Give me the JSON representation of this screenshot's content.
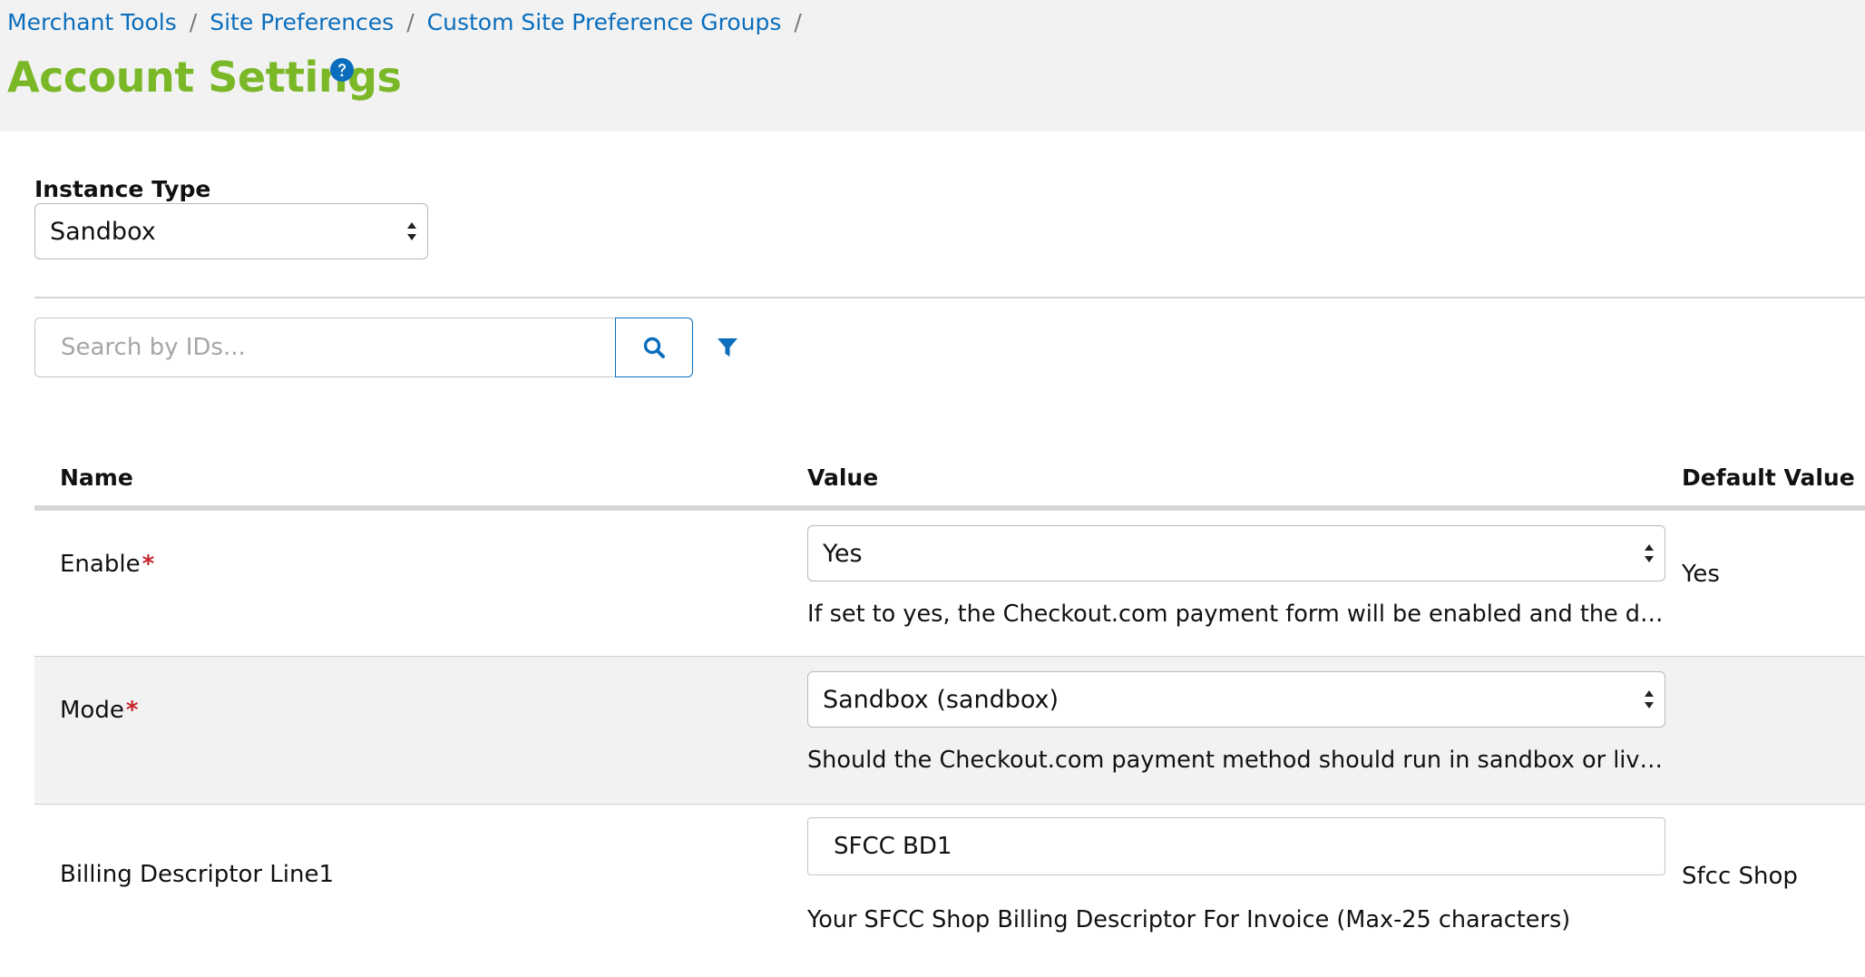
{
  "breadcrumb": {
    "items": [
      "Merchant Tools",
      "Site Preferences",
      "Custom Site Preference Groups"
    ],
    "separator": "/"
  },
  "page": {
    "title": "Account Settings",
    "help_icon": "question-circle-icon"
  },
  "instance_type": {
    "label": "Instance Type",
    "selected": "Sandbox"
  },
  "search": {
    "placeholder": "Search by IDs...",
    "value": "",
    "search_icon": "magnifier-icon",
    "filter_icon": "funnel-icon"
  },
  "table": {
    "columns": {
      "name": "Name",
      "value": "Value",
      "default": "Default Value"
    },
    "rows": [
      {
        "name": "Enable",
        "required_mark": "*",
        "value": "Yes",
        "description": "If set to yes, the Checkout.com payment form will be enabled and the def…",
        "default": "Yes"
      },
      {
        "name": "Mode",
        "required_mark": "*",
        "value": "Sandbox (sandbox)",
        "description": "Should the Checkout.com payment method should run in sandbox or live …",
        "default": ""
      },
      {
        "name": "Billing Descriptor Line1",
        "value": "SFCC BD1",
        "description": "Your SFCC Shop Billing Descriptor For Invoice (Max-25 characters)",
        "default": "Sfcc Shop"
      }
    ]
  },
  "colors": {
    "title_green": "#7ab828",
    "link_blue": "#0a6ebd",
    "required_red": "#c8262e",
    "header_bg": "#f2f2f2"
  }
}
